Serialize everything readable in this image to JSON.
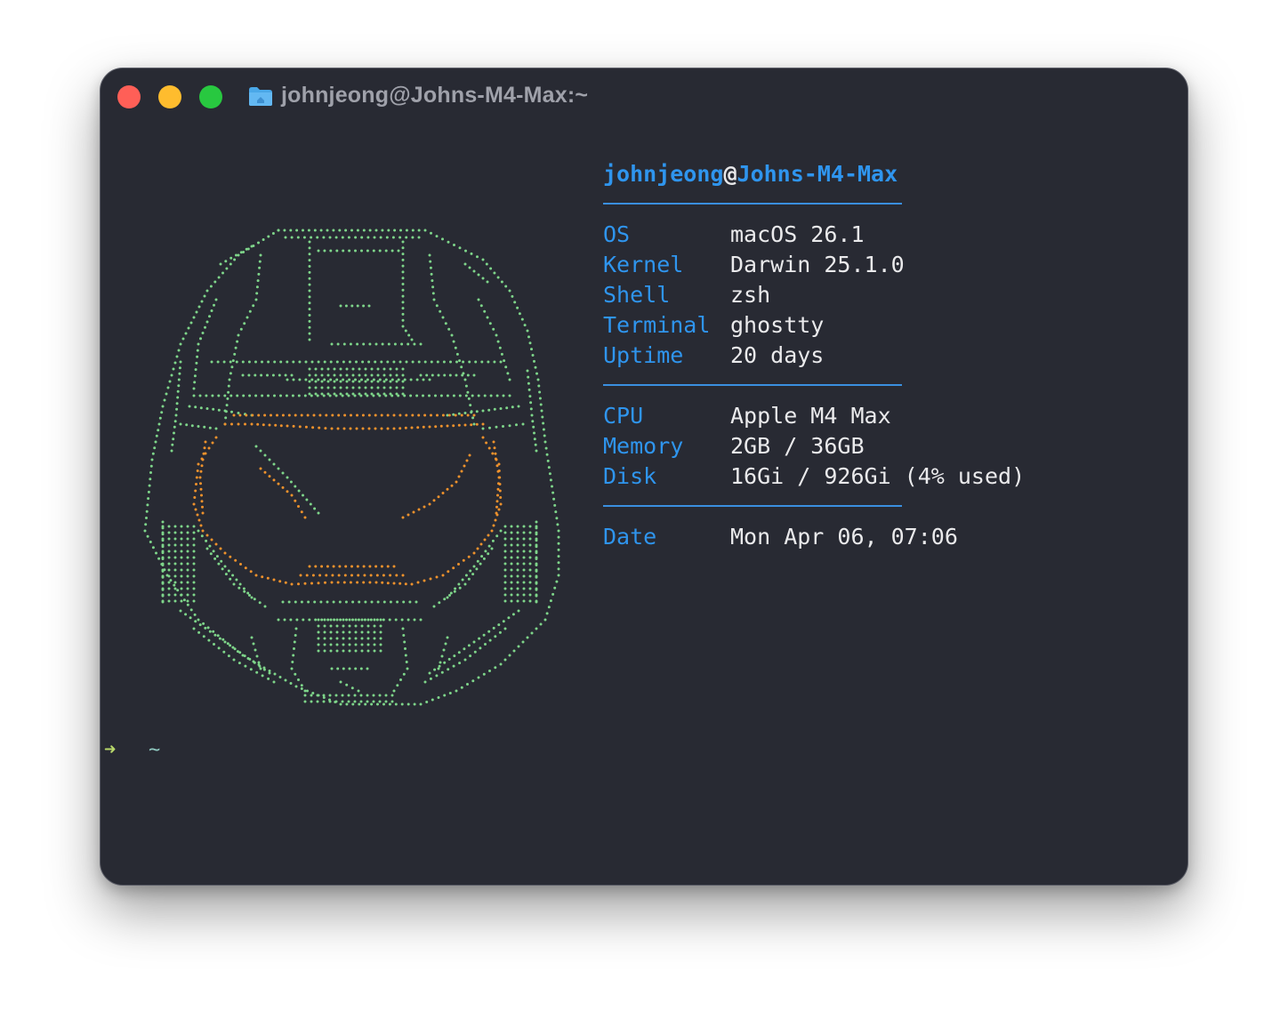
{
  "window": {
    "title": "johnjeong@Johns-M4-Max:~"
  },
  "icons": {
    "title_icon": "folder-home-icon",
    "traffic_lights": [
      "close",
      "minimize",
      "zoom"
    ]
  },
  "colors": {
    "background": "#282a33",
    "accent_blue": "#2f95ee",
    "art_green": "#7ed58a",
    "art_orange": "#f0922c",
    "prompt_arrow": "#b8d86a"
  },
  "info": {
    "user": "johnjeong",
    "at": "@",
    "host": "Johns-M4-Max",
    "groups": [
      [
        {
          "key": "OS",
          "value": "macOS 26.1"
        },
        {
          "key": "Kernel",
          "value": "Darwin 25.1.0"
        },
        {
          "key": "Shell",
          "value": "zsh"
        },
        {
          "key": "Terminal",
          "value": "ghostty"
        },
        {
          "key": "Uptime",
          "value": "20 days"
        }
      ],
      [
        {
          "key": "CPU",
          "value": "Apple M4 Max"
        },
        {
          "key": "Memory",
          "value": "2GB / 36GB"
        },
        {
          "key": "Disk",
          "value": "16Gi / 926Gi (4% used)"
        }
      ],
      [
        {
          "key": "Date",
          "value": "Mon Apr 06, 07:06"
        }
      ]
    ]
  },
  "prompt": {
    "arrow": "➜",
    "cwd": "~"
  }
}
